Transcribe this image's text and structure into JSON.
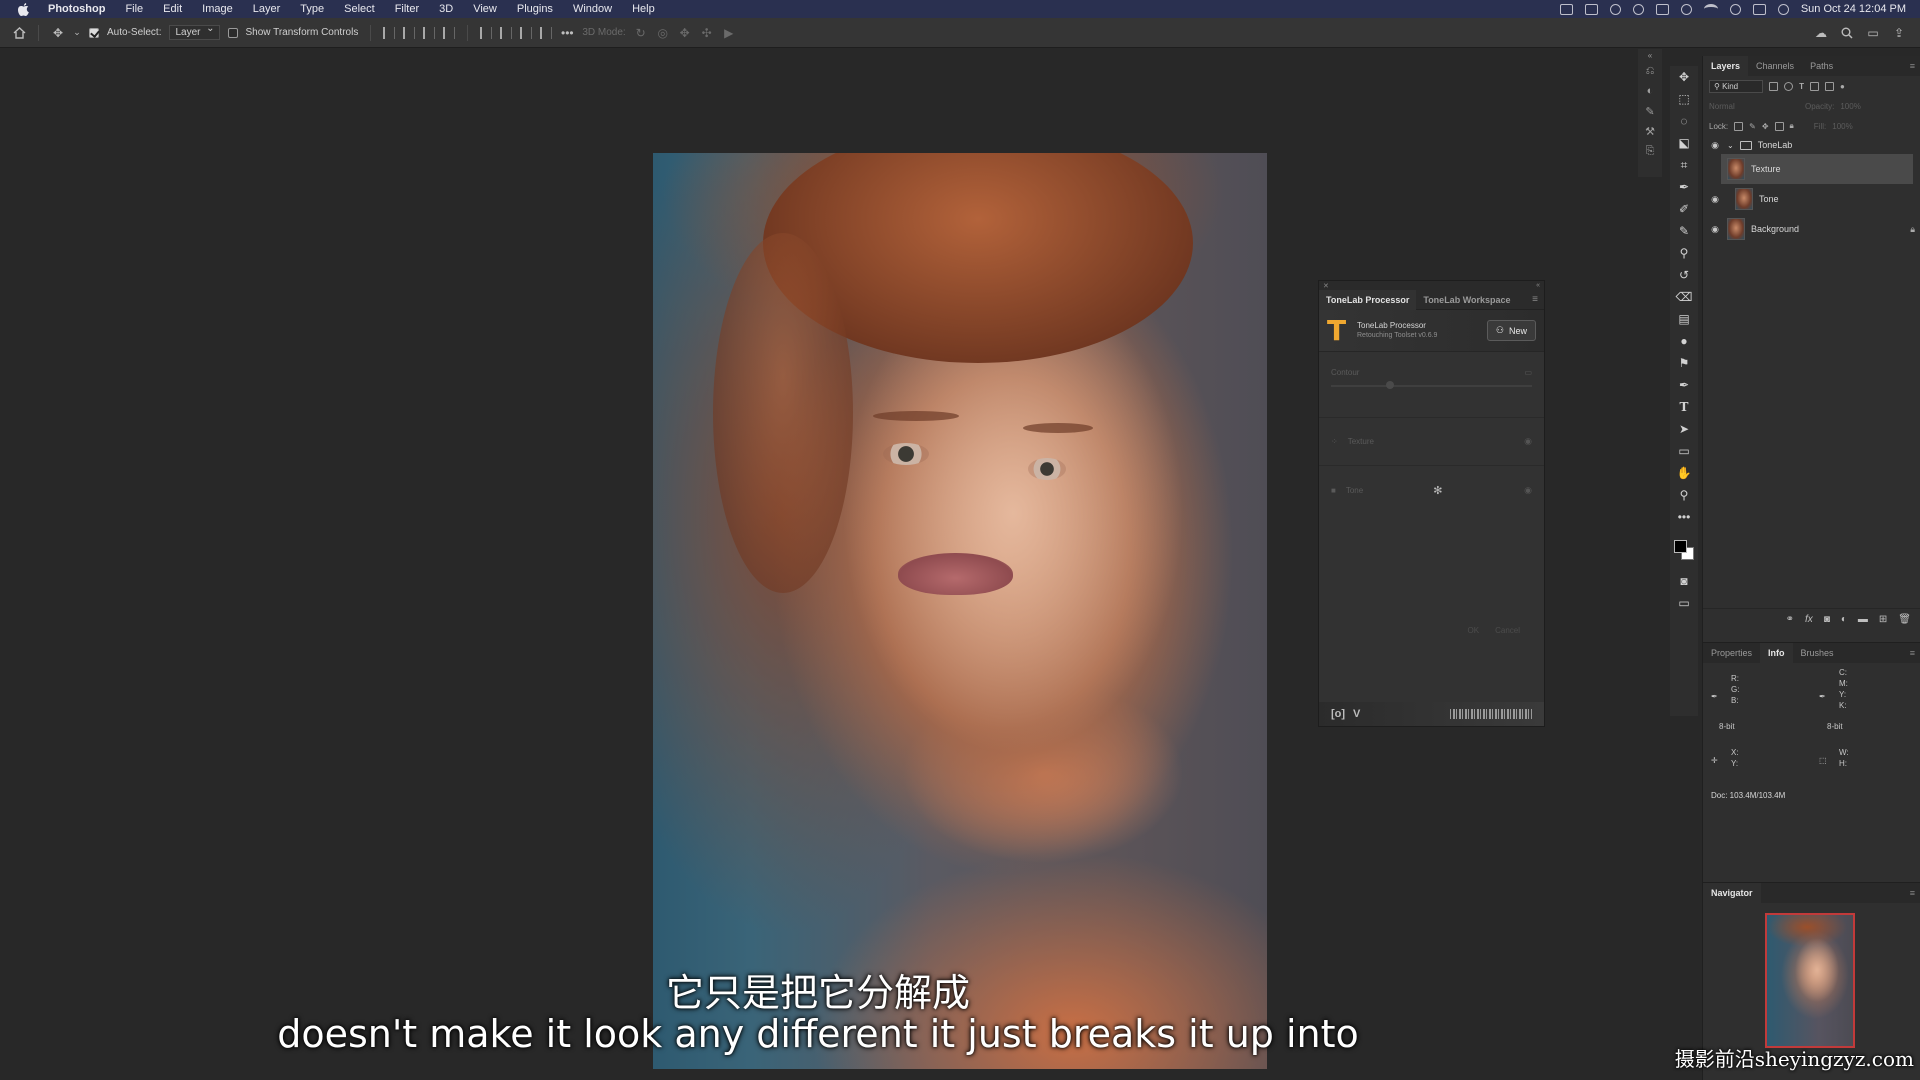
{
  "menubar": {
    "app": "Photoshop",
    "items": [
      "File",
      "Edit",
      "Image",
      "Layer",
      "Type",
      "Select",
      "Filter",
      "3D",
      "View",
      "Plugins",
      "Window",
      "Help"
    ],
    "clock": "Sun Oct 24  12:04 PM"
  },
  "options": {
    "auto_select_label": "Auto-Select:",
    "auto_select_checked": true,
    "auto_select_target": "Layer",
    "show_transform_label": "Show Transform Controls",
    "show_transform_checked": false,
    "mode_3d_label": "3D Mode:"
  },
  "subtitles": {
    "cn": "它只是把它分解成",
    "en": "doesn't make it look any different it just breaks it up into"
  },
  "watermark": "摄影前沿sheyingzyz.com",
  "plugin": {
    "tabs": [
      "ToneLab Processor",
      "ToneLab Workspace"
    ],
    "active_tab": "ToneLab Processor",
    "title": "ToneLab Processor",
    "subtitle": "Retouching Toolset v0.6.9",
    "new_button": "New",
    "contour_label": "Contour",
    "texture_label": "Texture",
    "tone_label": "Tone",
    "ok_label": "OK",
    "cancel_label": "Cancel",
    "footer_badge": "[o]",
    "footer_v": "V"
  },
  "layers": {
    "tabs": [
      "Layers",
      "Channels",
      "Paths"
    ],
    "active_tab": "Layers",
    "kind_label": "Kind",
    "blend_mode": "Normal",
    "opacity_label": "Opacity:",
    "opacity_value": "100%",
    "lock_label": "Lock:",
    "fill_label": "Fill:",
    "fill_value": "100%",
    "group": {
      "name": "ToneLab",
      "expanded": true
    },
    "items": [
      {
        "name": "Texture",
        "visible": false,
        "selected": true,
        "locked": false
      },
      {
        "name": "Tone",
        "visible": true,
        "selected": false,
        "locked": false
      },
      {
        "name": "Background",
        "visible": true,
        "selected": false,
        "locked": true
      }
    ]
  },
  "info": {
    "tabs": [
      "Properties",
      "Info",
      "Brushes"
    ],
    "active_tab": "Info",
    "rgb_labels": [
      "R:",
      "G:",
      "B:"
    ],
    "cmyk_labels": [
      "C:",
      "M:",
      "Y:",
      "K:"
    ],
    "bit_depth_left": "8-bit",
    "bit_depth_right": "8-bit",
    "xy_labels": [
      "X:",
      "Y:"
    ],
    "wh_labels": [
      "W:",
      "H:"
    ],
    "doc": "Doc: 103.4M/103.4M"
  },
  "navigator": {
    "title": "Navigator"
  },
  "icons": {
    "tools": [
      "move-icon",
      "marquee-icon",
      "lasso-icon",
      "object-select-icon",
      "crop-icon",
      "eyedropper-icon",
      "healing-brush-icon",
      "brush-icon",
      "clone-stamp-icon",
      "history-brush-icon",
      "eraser-icon",
      "gradient-icon",
      "blur-icon",
      "dodge-icon",
      "pen-icon",
      "type-icon",
      "path-select-icon",
      "rectangle-icon",
      "hand-icon",
      "zoom-icon",
      "more-tools-icon"
    ]
  }
}
